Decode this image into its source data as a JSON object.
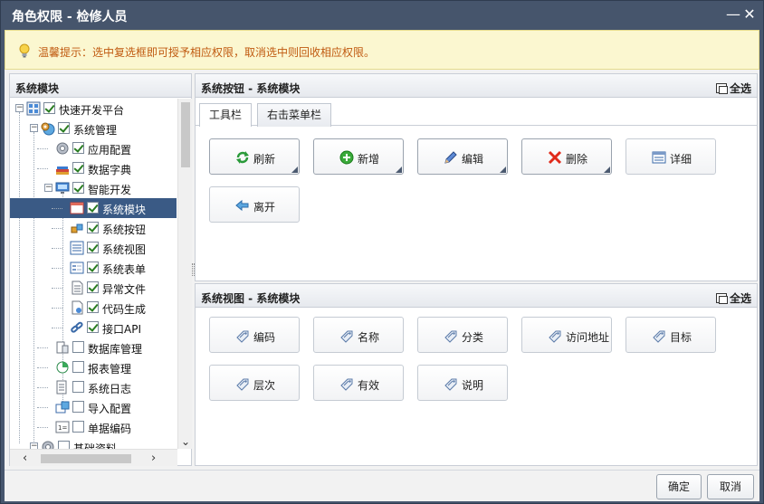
{
  "window": {
    "title": "角色权限 - 检修人员",
    "minimize_label": "—",
    "close_label": "✕"
  },
  "notice": {
    "text": "温馨提示：选中复选框即可授予相应权限，取消选中则回收相应权限。"
  },
  "left_panel": {
    "title": "系统模块"
  },
  "tree": [
    {
      "label": "快速开发平台",
      "checked": true,
      "icon": "grid-icon"
    },
    {
      "label": "系统管理",
      "checked": true,
      "icon": "gears-globe-icon"
    },
    {
      "label": "应用配置",
      "checked": true,
      "icon": "gear-icon"
    },
    {
      "label": "数据字典",
      "checked": true,
      "icon": "books-icon"
    },
    {
      "label": "智能开发",
      "checked": true,
      "icon": "monitor-icon"
    },
    {
      "label": "系统模块",
      "checked": true,
      "icon": "window-icon",
      "selected": true
    },
    {
      "label": "系统按钮",
      "checked": true,
      "icon": "cubes-icon"
    },
    {
      "label": "系统视图",
      "checked": true,
      "icon": "list-view-icon"
    },
    {
      "label": "系统表单",
      "checked": true,
      "icon": "form-icon"
    },
    {
      "label": "异常文件",
      "checked": true,
      "icon": "document-icon"
    },
    {
      "label": "代码生成",
      "checked": true,
      "icon": "code-file-icon"
    },
    {
      "label": "接口API",
      "checked": true,
      "icon": "link-icon"
    },
    {
      "label": "数据库管理",
      "checked": false,
      "icon": "database-icon"
    },
    {
      "label": "报表管理",
      "checked": false,
      "icon": "report-icon"
    },
    {
      "label": "系统日志",
      "checked": false,
      "icon": "log-icon"
    },
    {
      "label": "导入配置",
      "checked": false,
      "icon": "import-icon"
    },
    {
      "label": "单据编码",
      "checked": false,
      "icon": "code-list-icon"
    },
    {
      "label": "基础资料",
      "checked": false,
      "icon": "gear-icon"
    }
  ],
  "buttons_panel": {
    "title": "系统按钮 - 系统模块",
    "select_all": "全选",
    "tabs": [
      {
        "label": "工具栏"
      },
      {
        "label": "右击菜单栏"
      }
    ],
    "buttons": [
      {
        "label": "刷新",
        "icon": "refresh-icon",
        "checked": true
      },
      {
        "label": "新增",
        "icon": "add-icon",
        "checked": true
      },
      {
        "label": "编辑",
        "icon": "pencil-icon",
        "checked": true
      },
      {
        "label": "删除",
        "icon": "delete-icon",
        "checked": true
      },
      {
        "label": "详细",
        "icon": "detail-icon",
        "checked": false
      },
      {
        "label": "离开",
        "icon": "exit-icon",
        "checked": false
      }
    ]
  },
  "views_panel": {
    "title": "系统视图 - 系统模块",
    "select_all": "全选",
    "fields": [
      {
        "label": "编码"
      },
      {
        "label": "名称"
      },
      {
        "label": "分类"
      },
      {
        "label": "访问地址"
      },
      {
        "label": "目标"
      },
      {
        "label": "层次"
      },
      {
        "label": "有效"
      },
      {
        "label": "说明"
      }
    ]
  },
  "footer": {
    "confirm": "确定",
    "cancel": "取消"
  },
  "colors": {
    "titlebar": "#46556c",
    "selected_row": "#3a5a85",
    "notice_text": "#c05a10",
    "notice_bg": "#fbf7d0"
  }
}
